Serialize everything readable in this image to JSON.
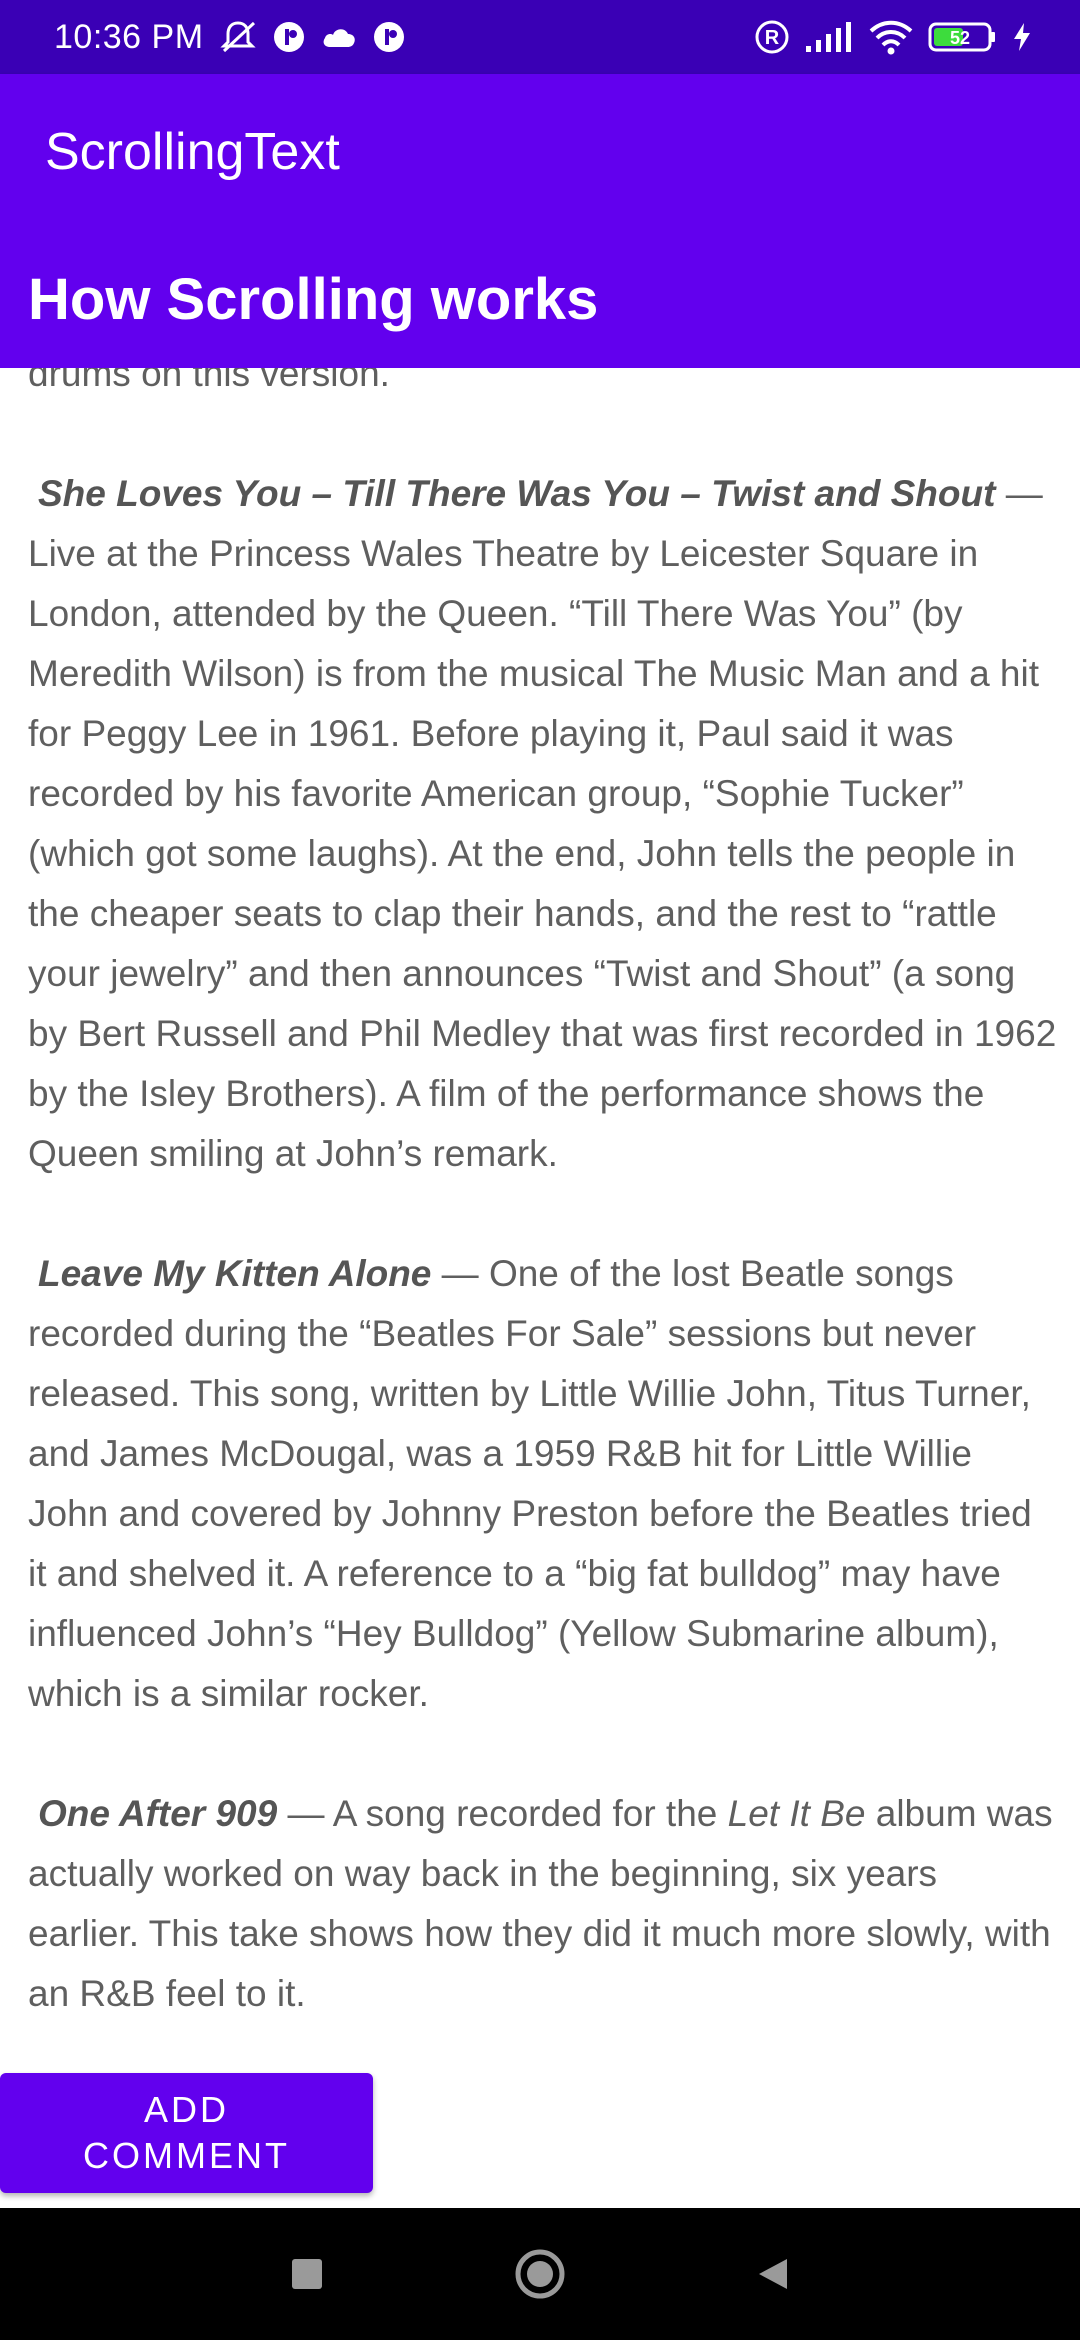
{
  "status_bar": {
    "time": "10:36 PM",
    "battery_level": "52",
    "left_icons": [
      "muted-bell-icon",
      "notification-icon",
      "cloud-icon",
      "notification-icon"
    ],
    "right_icons": [
      "registered-icon",
      "signal-icon",
      "wifi-icon",
      "battery-icon",
      "charging-icon"
    ]
  },
  "app_bar": {
    "title": "ScrollingText"
  },
  "heading": {
    "text": "How Scrolling works"
  },
  "article": {
    "intro_tail": "drums on this version.",
    "p1": {
      "title": "She Loves You – Till There Was You – Twist and Shout",
      "body": " — Live at the Princess Wales Theatre by Leicester Square in London, attended by the Queen. “Till There Was You” (by Meredith Wilson) is from the musical The Music Man and a hit for Peggy Lee in 1961. Before playing it, Paul said it was recorded by his favorite American group, “Sophie Tucker” (which got some laughs). At the end, John tells the people in the cheaper seats to clap their hands, and the rest to “rattle your jewelry” and then announces “Twist and Shout” (a song by Bert Russell and Phil Medley that was first recorded in 1962 by the Isley Brothers). A film of the performance shows the Queen smiling at John’s remark."
    },
    "p2": {
      "title": "Leave My Kitten Alone",
      "body": " — One of the lost Beatle songs recorded during the “Beatles For Sale” sessions but never released. This song, written by Little Willie John, Titus Turner, and James McDougal, was a 1959 R&B hit for Little Willie John and covered by Johnny Preston before the Beatles tried it and shelved it. A reference to a “big fat bulldog” may have influenced John’s “Hey Bulldog” (Yellow Submarine album), which is a similar rocker."
    },
    "p3": {
      "title": "One After 909",
      "body_before": " — A song recorded for the ",
      "album": "Let It Be",
      "body_after": " album was actually worked on way back in the beginning, six years earlier. This take shows how they did it much more slowly, with an R&B feel to it."
    }
  },
  "button": {
    "line1": "ADD",
    "line2": "COMMENT"
  },
  "nav_bar": {
    "icons": [
      "recents-square-icon",
      "home-circle-icon",
      "back-triangle-icon"
    ]
  },
  "colors": {
    "status_bar": "#3a00b5",
    "primary": "#6200ee",
    "body_text": "#5f5f5f",
    "nav_bar": "#000000"
  }
}
